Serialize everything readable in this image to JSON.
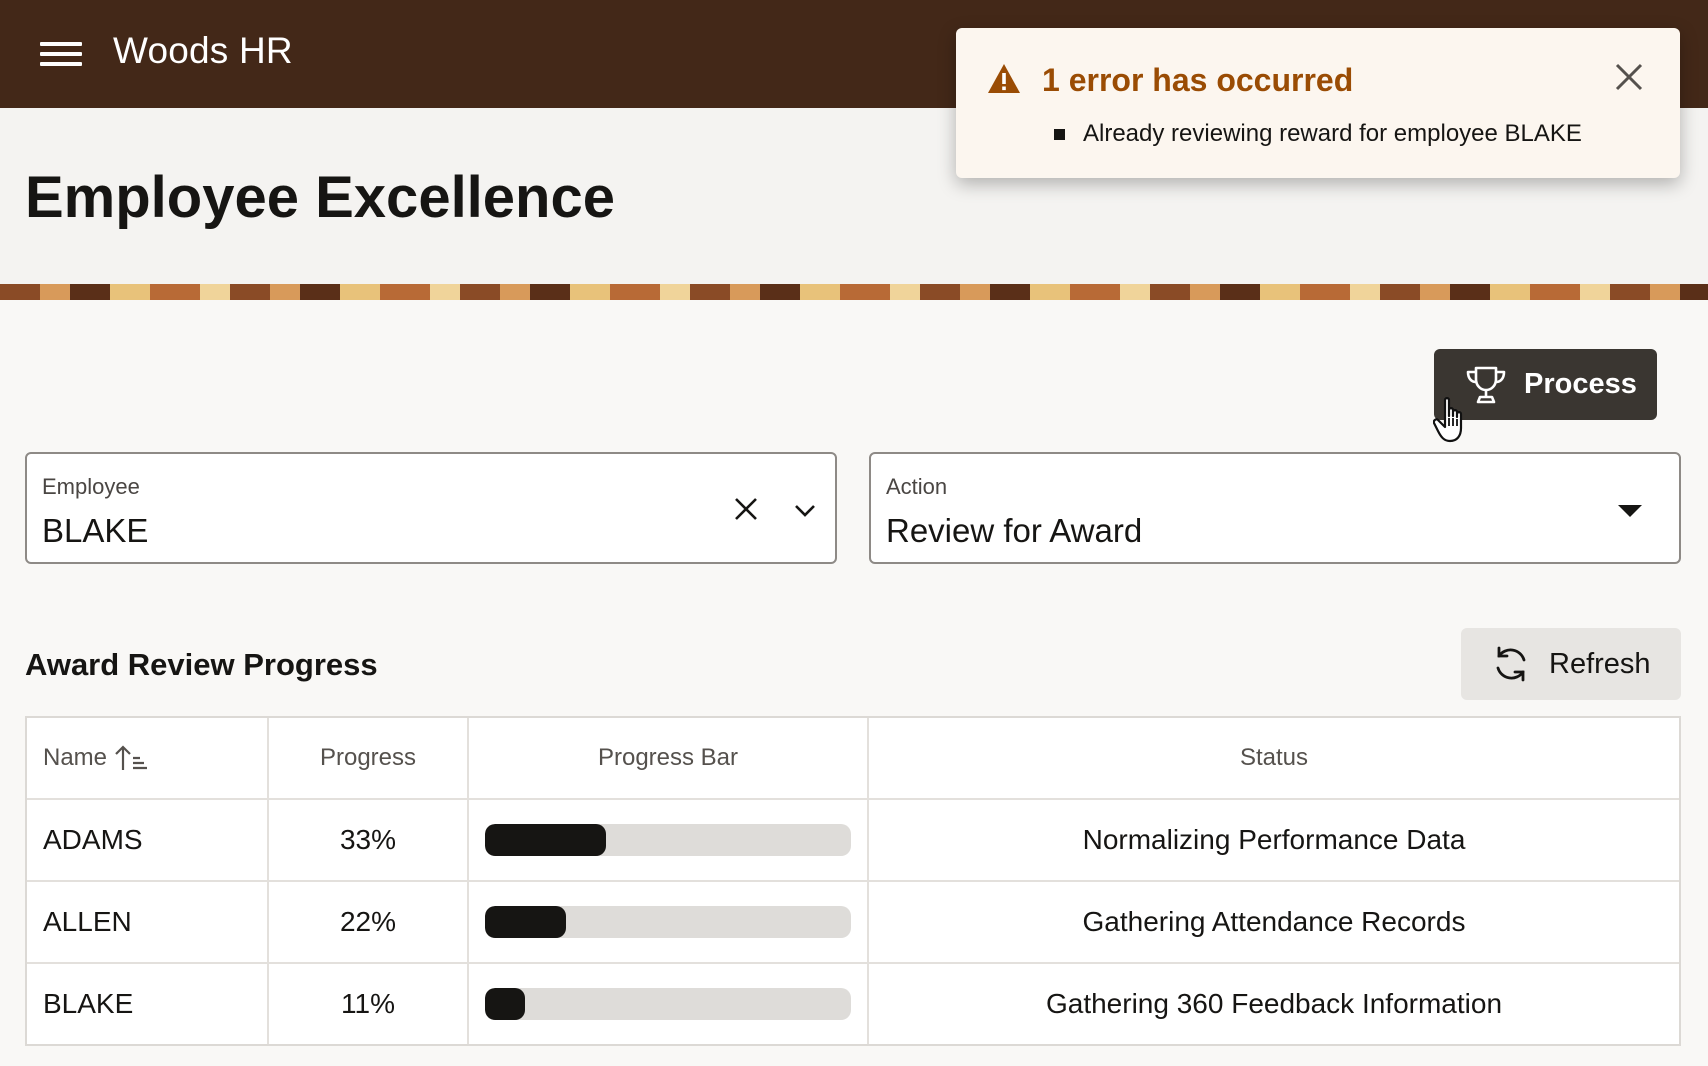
{
  "header": {
    "app_title": "Woods HR",
    "menu_icon": "hamburger-menu-icon"
  },
  "page": {
    "title": "Employee Excellence"
  },
  "toolbar": {
    "process_label": "Process",
    "process_icon": "trophy-icon"
  },
  "form": {
    "employee": {
      "label": "Employee",
      "value": "BLAKE"
    },
    "action": {
      "label": "Action",
      "value": "Review for Award"
    }
  },
  "section": {
    "title": "Award Review Progress",
    "refresh_label": "Refresh",
    "refresh_icon": "refresh-icon"
  },
  "table": {
    "columns": [
      "Name",
      "Progress",
      "Progress Bar",
      "Status"
    ],
    "sort": "ascending",
    "rows": [
      {
        "name": "ADAMS",
        "progress": "33%",
        "progress_value": 33,
        "status": "Normalizing Performance Data"
      },
      {
        "name": "ALLEN",
        "progress": "22%",
        "progress_value": 22,
        "status": "Gathering Attendance Records"
      },
      {
        "name": "BLAKE",
        "progress": "11%",
        "progress_value": 11,
        "status": "Gathering 360 Feedback Information"
      }
    ]
  },
  "toast": {
    "title": "1 error has occurred",
    "messages": [
      "Already reviewing reward for employee BLAKE"
    ],
    "icon": "warning-icon",
    "accent_color": "#9a4c04"
  },
  "colors": {
    "header_bg": "#432818",
    "primary_button": "#3a3631",
    "bar_fill": "#161513"
  }
}
